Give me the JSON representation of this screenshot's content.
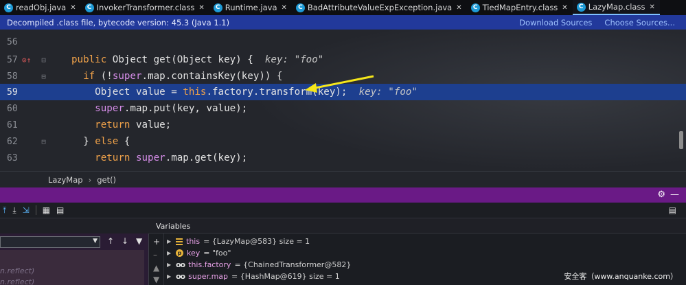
{
  "tabs": [
    {
      "label": "readObj.java",
      "icon": "class-icon"
    },
    {
      "label": "InvokerTransformer.class",
      "icon": "class-icon"
    },
    {
      "label": "Runtime.java",
      "icon": "class-icon"
    },
    {
      "label": "BadAttributeValueExpException.java",
      "icon": "class-icon"
    },
    {
      "label": "TiedMapEntry.class",
      "icon": "class-icon"
    },
    {
      "label": "LazyMap.class",
      "icon": "class-icon"
    }
  ],
  "banner": {
    "text": "Decompiled .class file, bytecode version: 45.3 (Java 1.1)",
    "download_sources": "Download Sources",
    "choose_sources": "Choose Sources..."
  },
  "editor": {
    "lines": [
      {
        "num": "56"
      },
      {
        "num": "57"
      },
      {
        "num": "58"
      },
      {
        "num": "59"
      },
      {
        "num": "60"
      },
      {
        "num": "61"
      },
      {
        "num": "62"
      },
      {
        "num": "63"
      }
    ],
    "code": {
      "l57_a": "public",
      "l57_b": " Object get(Object key) {",
      "l57_hint": "key: \"foo\"",
      "l58_a": "if",
      "l58_b": " (!",
      "l58_c": "super",
      "l58_d": ".map.containsKey(key)) {",
      "l59_a": "Object value = ",
      "l59_b": "this",
      "l59_c": ".factory.transform(key);",
      "l59_hint": "key: \"foo\"",
      "l60_a": "super",
      "l60_b": ".map.put(key, value);",
      "l61_a": "return",
      "l61_b": " value;",
      "l62_a": "} ",
      "l62_b": "else",
      "l62_c": " {",
      "l63_a": "return",
      "l63_b": " ",
      "l63_c": "super",
      "l63_d": ".map.get(key);"
    }
  },
  "breadcrumb": {
    "class": "LazyMap",
    "method": "get()"
  },
  "frames": {
    "rows": [
      "n.reflect)",
      "n.reflect)"
    ]
  },
  "variables": {
    "tab_label": "Variables",
    "rows": [
      {
        "name": "this",
        "value": " = {LazyMap@583}  size = 1"
      },
      {
        "name": "key",
        "value": " = \"foo\""
      },
      {
        "name": "this.factory",
        "value": " = {ChainedTransformer@582}"
      },
      {
        "name": "super.map",
        "value": " = {HashMap@619}  size = 1"
      }
    ]
  },
  "watermark": "安全客（www.anquanke.com）",
  "colors": {
    "highlight_line": "#1d3f8f",
    "banner": "#22399b",
    "debug_bar": "#6a1a86",
    "keyword": "#f0a24a",
    "arrow": "#f5e61a"
  }
}
